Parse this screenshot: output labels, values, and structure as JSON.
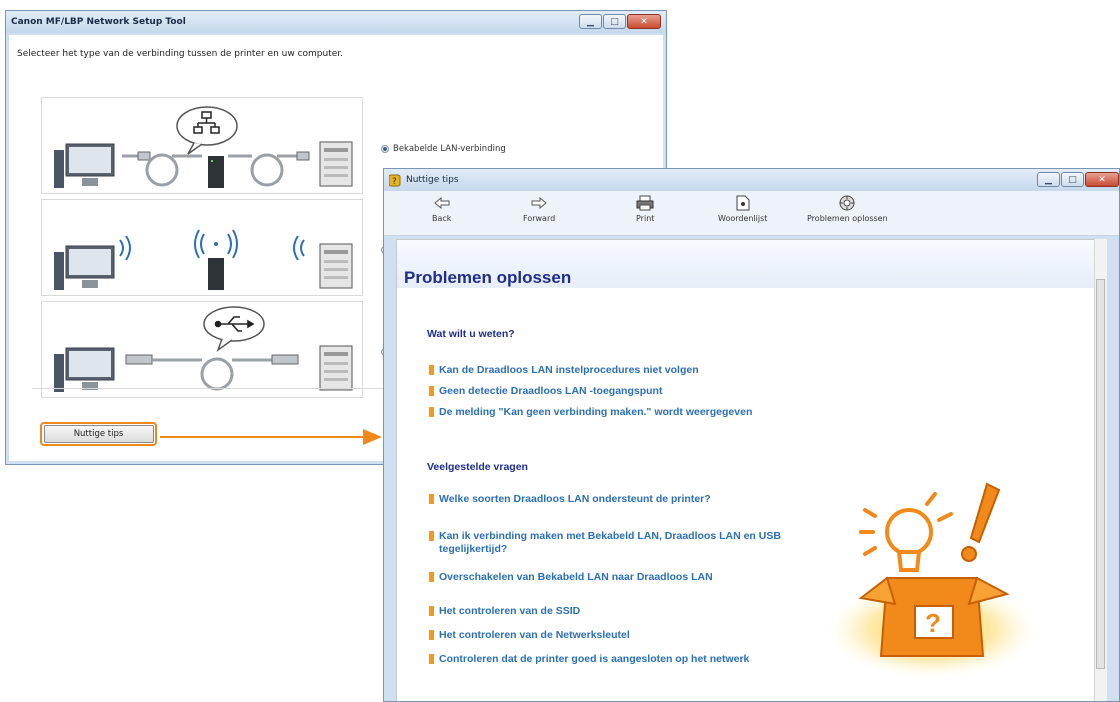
{
  "setup_window": {
    "title": "Canon MF/LBP Network Setup Tool",
    "instruction": "Selecteer het type van de verbinding tussen de printer en uw computer.",
    "option_wired": "Bekabelde LAN-verbinding",
    "tips_button": "Nuttige tips"
  },
  "tips_window": {
    "title": "Nuttige tips",
    "toolbar": {
      "back": "Back",
      "forward": "Forward",
      "print": "Print",
      "glossary": "Woordenlijst",
      "troubleshoot": "Problemen oplossen"
    },
    "heading": "Problemen oplossen",
    "section1": {
      "title": "Wat wilt u weten?",
      "links": [
        "Kan de Draadloos LAN instelprocedures niet volgen",
        "Geen detectie Draadloos LAN -toegangspunt",
        "De melding \"Kan geen verbinding maken.\" wordt weergegeven"
      ]
    },
    "section2": {
      "title": "Veelgestelde vragen",
      "links": [
        "Welke soorten Draadloos LAN ondersteunt de printer?",
        "Kan ik verbinding maken met Bekabeld LAN, Draadloos LAN en USB tegelijkertijd?",
        "Overschakelen van Bekabeld LAN naar Draadloos LAN",
        "Het controleren van de SSID",
        "Het controleren van de Netwerksleutel",
        "Controleren dat de printer goed is aangesloten op het netwerk"
      ]
    }
  },
  "colors": {
    "accent_orange": "#f0891a",
    "link_blue": "#2b6fb7",
    "heading_navy": "#1f2d8e"
  }
}
